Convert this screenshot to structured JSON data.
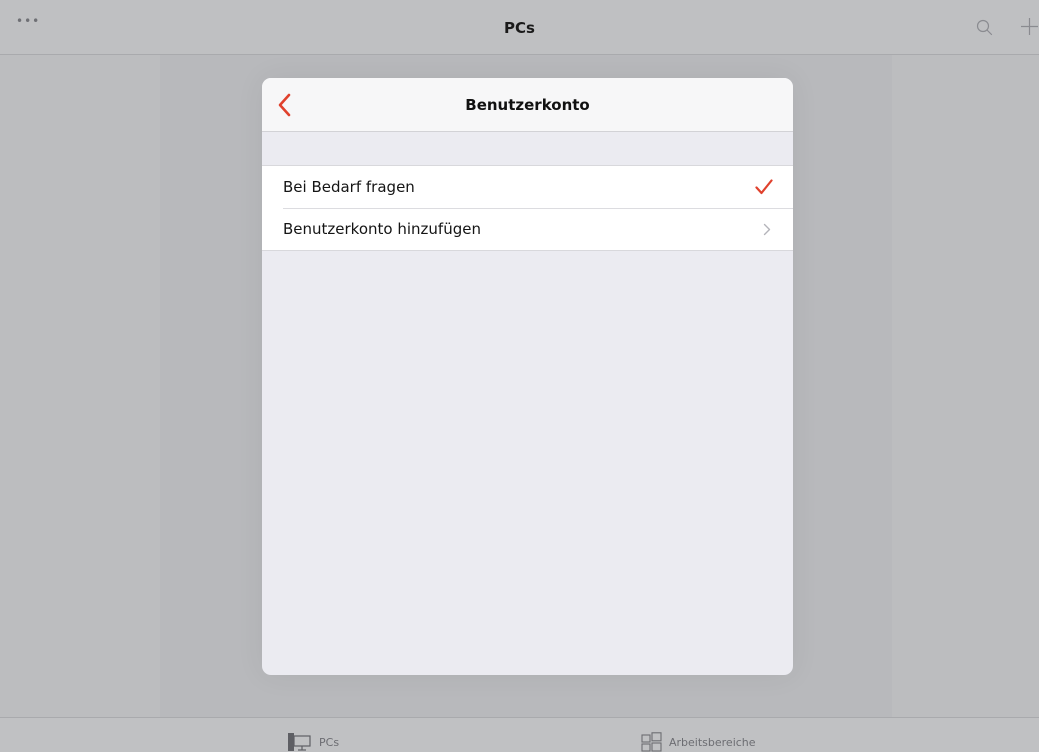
{
  "app": {
    "title": "PCs",
    "more_label": "•••",
    "icons": {
      "search": "search-icon",
      "add": "plus-icon"
    }
  },
  "tabbar": {
    "tabs": [
      {
        "label": "PCs",
        "icon": "pcs-icon"
      },
      {
        "label": "Arbeitsbereiche",
        "icon": "workspaces-icon"
      }
    ]
  },
  "modal": {
    "title": "Benutzerkonto",
    "back_icon": "chevron-left-icon",
    "accent_color": "#e0412d",
    "items": [
      {
        "label": "Bei Bedarf fragen",
        "accessory": "checkmark-icon",
        "selected": true
      },
      {
        "label": "Benutzerkonto hinzufügen",
        "accessory": "chevron-right-icon",
        "selected": false
      }
    ]
  }
}
